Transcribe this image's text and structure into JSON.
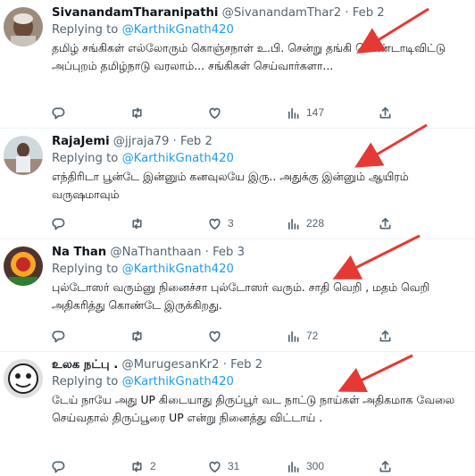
{
  "colors": {
    "accent": "#1d9bf0",
    "muted": "#536471",
    "text": "#0f1419",
    "arrow": "#e53935"
  },
  "tweets": [
    {
      "name": "SivanandamTharanipathi",
      "handle": "@SivanandamThar2",
      "sep": "·",
      "date": "Feb 2",
      "reply_prefix": "Replying to",
      "reply_to": "@KarthikGnath420",
      "text": "தமிழ் சங்கிகள் எல்லோரும் கொஞ்சநாள் உ.பி. சென்று தங்கி கொண்டாடிவிட்டு அப்புறம் தமிழ்நாடு வரலாம்... சங்கிகள் செய்வார்களா...",
      "replies": "",
      "retweets": "",
      "likes": "",
      "views": "147",
      "avatar_icon": "profile-photo"
    },
    {
      "name": "RajaJemi",
      "handle": "@jjraja79",
      "sep": "·",
      "date": "Feb 2",
      "reply_prefix": "Replying to",
      "reply_to": "@KarthikGnath420",
      "text": "எந்திரிடா பூன்டே இன்னும் கனவுலயே இரு.. அதுக்கு இன்னும் ஆயிரம் வருஷமாவும்",
      "replies": "",
      "retweets": "",
      "likes": "3",
      "views": "228",
      "avatar_icon": "profile-photo"
    },
    {
      "name": "Na Than",
      "handle": "@NaThanthaan",
      "sep": "·",
      "date": "Feb 3",
      "reply_prefix": "Replying to",
      "reply_to": "@KarthikGnath420",
      "text": "புல்டோஸர் வரும்னு நினைச்சா புல்டோஸர் வரும். சாதி வெறி , மதம் வெறி அதிகரித்து கொண்டே இருக்கிறது.",
      "replies": "",
      "retweets": "",
      "likes": "",
      "views": "72",
      "avatar_icon": "profile-photo"
    },
    {
      "name": "உலக நட்பு .",
      "handle": "@MurugesanKr2",
      "sep": "·",
      "date": "Feb 2",
      "reply_prefix": "Replying to",
      "reply_to": "@KarthikGnath420",
      "text": "டேய் நாயே அது UP கிடையாது திருப்பூர் வட நாட்டு நாய்கள் அதிகமாக வேலை செய்வதால் திருப்பூரை UP என்று நினைத்து விட்டாய் .",
      "replies": "",
      "retweets": "2",
      "likes": "31",
      "views": "300",
      "avatar_icon": "profile-photo"
    }
  ]
}
